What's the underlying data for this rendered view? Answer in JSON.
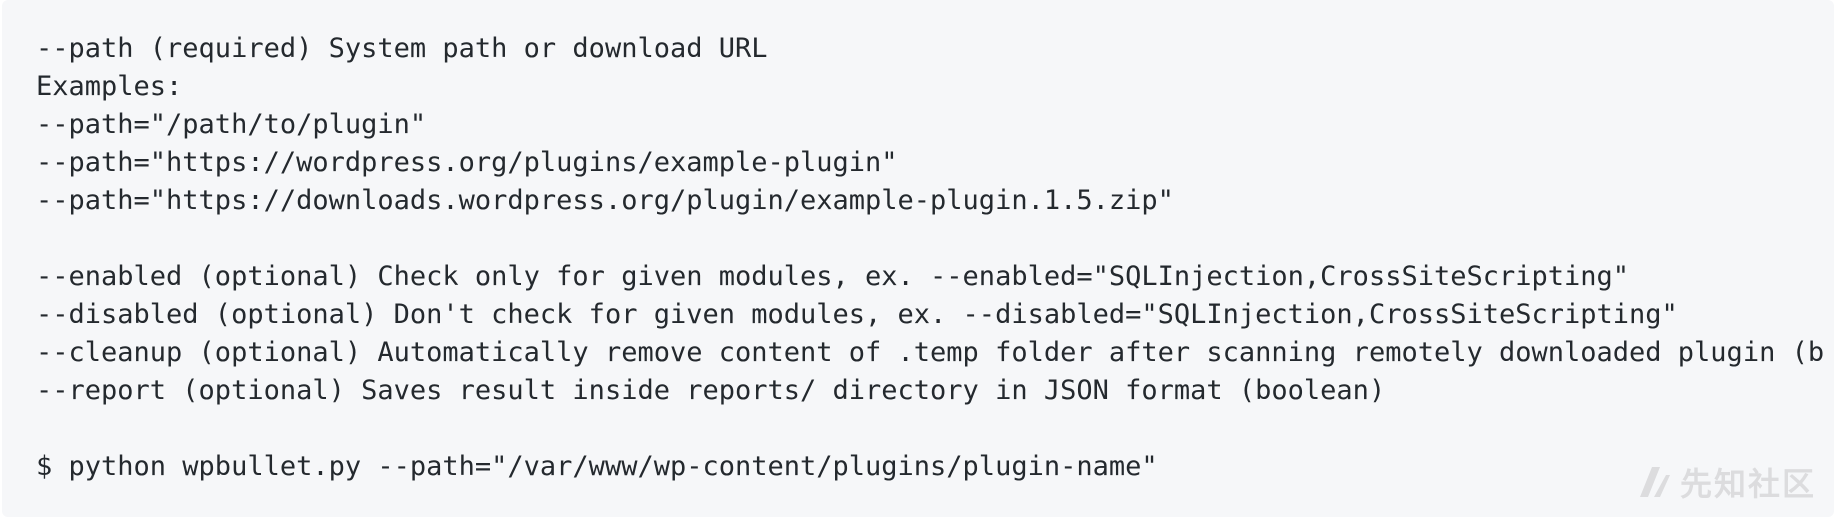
{
  "code_block": {
    "lines": [
      "--path (required) System path or download URL",
      "Examples:",
      "--path=\"/path/to/plugin\"",
      "--path=\"https://wordpress.org/plugins/example-plugin\"",
      "--path=\"https://downloads.wordpress.org/plugin/example-plugin.1.5.zip\"",
      "",
      "--enabled (optional) Check only for given modules, ex. --enabled=\"SQLInjection,CrossSiteScripting\"",
      "--disabled (optional) Don't check for given modules, ex. --disabled=\"SQLInjection,CrossSiteScripting\"",
      "--cleanup (optional) Automatically remove content of .temp folder after scanning remotely downloaded plugin (b",
      "--report (optional) Saves result inside reports/ directory in JSON format (boolean)",
      "",
      "$ python wpbullet.py --path=\"/var/www/wp-content/plugins/plugin-name\""
    ]
  },
  "watermark": {
    "text": "先知社区",
    "icon": "xianzhi-logo-icon"
  }
}
